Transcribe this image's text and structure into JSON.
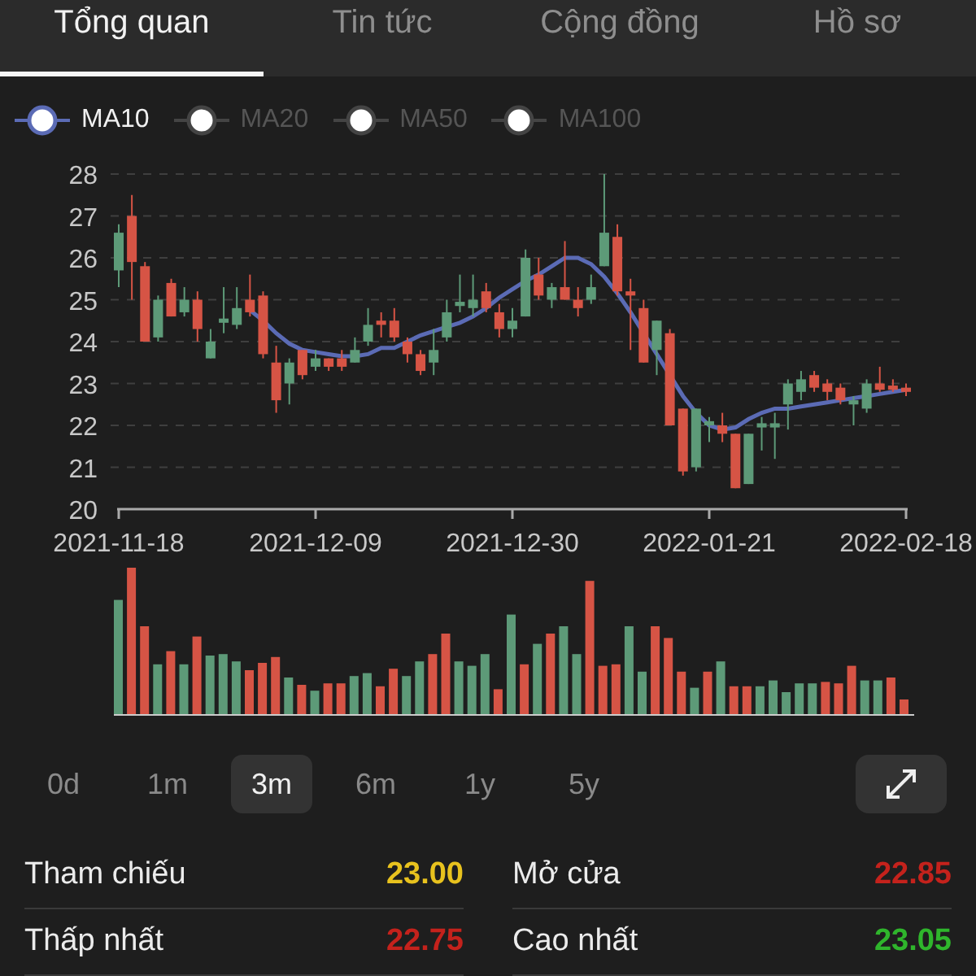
{
  "tabs": [
    {
      "label": "Tổng quan",
      "selected": true
    },
    {
      "label": "Tin tức",
      "selected": false
    },
    {
      "label": "Cộng đồng",
      "selected": false
    },
    {
      "label": "Hồ sơ",
      "selected": false
    }
  ],
  "ma_toggles": [
    {
      "kind": "series",
      "selected": true
    },
    {
      "kind": "plain",
      "label": "MA20",
      "selected": false
    },
    {
      "kind": "plain",
      "label": "MA50",
      "selected": false
    },
    {
      "kind": "plain",
      "label": "MA100",
      "selected": false
    }
  ],
  "price_chart": {
    "chart_data": {
      "type": "candlestick",
      "grid": true,
      "ylim": [
        20,
        28
      ],
      "yticks": [
        20,
        21,
        22,
        23,
        24,
        25,
        26,
        27,
        28
      ],
      "categories": [
        "2021-11-18",
        null,
        null,
        null,
        null,
        null,
        null,
        null,
        null,
        null,
        null,
        null,
        null,
        null,
        null,
        "2021-12-09",
        null,
        null,
        null,
        null,
        null,
        null,
        null,
        null,
        null,
        null,
        null,
        null,
        null,
        null,
        "2021-12-30",
        null,
        null,
        null,
        null,
        null,
        null,
        null,
        null,
        null,
        null,
        null,
        null,
        null,
        null,
        "2022-01-21",
        null,
        null,
        null,
        null,
        null,
        null,
        null,
        null,
        null,
        null,
        null,
        null,
        null,
        null,
        "2022-02-18"
      ],
      "ohlc": [
        [
          25.7,
          26.8,
          25.3,
          26.6
        ],
        [
          27,
          27.5,
          25,
          25.9
        ],
        [
          25.8,
          25.9,
          24,
          24
        ],
        [
          24.1,
          25.1,
          24,
          25
        ],
        [
          25.4,
          25.5,
          24.6,
          24.6
        ],
        [
          24.7,
          25.3,
          24.6,
          25
        ],
        [
          25,
          25.2,
          24,
          24.3
        ],
        [
          23.6,
          24.3,
          23.6,
          24
        ],
        [
          24.45,
          25.3,
          24.2,
          24.55
        ],
        [
          24.4,
          25.3,
          24.3,
          24.8
        ],
        [
          25,
          25.6,
          24.6,
          24.7
        ],
        [
          25.1,
          25.2,
          23.6,
          23.7
        ],
        [
          23.5,
          23.9,
          22.3,
          22.6
        ],
        [
          23,
          23.6,
          22.5,
          23.5
        ],
        [
          23.8,
          23.8,
          23.1,
          23.2
        ],
        [
          23.4,
          23.8,
          23.3,
          23.6
        ],
        [
          23.6,
          23.6,
          23.3,
          23.4
        ],
        [
          23.6,
          23.8,
          23.3,
          23.4
        ],
        [
          23.5,
          24.1,
          23.5,
          23.8
        ],
        [
          24,
          24.8,
          23.9,
          24.4
        ],
        [
          24.5,
          24.7,
          24.1,
          24.4
        ],
        [
          24.5,
          24.8,
          24,
          24.1
        ],
        [
          24,
          24.1,
          23.5,
          23.7
        ],
        [
          23.7,
          23.8,
          23.2,
          23.3
        ],
        [
          23.5,
          24.3,
          23.2,
          23.8
        ],
        [
          24.1,
          25,
          24,
          24.7
        ],
        [
          24.85,
          25.6,
          24.7,
          24.95
        ],
        [
          24.8,
          25.6,
          24.6,
          25
        ],
        [
          25.2,
          25.4,
          24.7,
          24.8
        ],
        [
          24.7,
          24.9,
          24.1,
          24.3
        ],
        [
          24.3,
          24.8,
          24.1,
          24.5
        ],
        [
          24.6,
          26.2,
          24.6,
          26
        ],
        [
          25.6,
          26,
          25,
          25.1
        ],
        [
          25,
          25.4,
          24.8,
          25.3
        ],
        [
          25.3,
          26.4,
          25,
          25
        ],
        [
          25,
          25.3,
          24.6,
          24.8
        ],
        [
          25,
          25.6,
          24.9,
          25.3
        ],
        [
          25.8,
          28,
          25.8,
          26.6
        ],
        [
          26.5,
          26.8,
          25.1,
          25.2
        ],
        [
          25.2,
          25.5,
          23.8,
          25.1
        ],
        [
          24.8,
          25,
          23.5,
          23.5
        ],
        [
          23.8,
          24.5,
          23.2,
          24.5
        ],
        [
          24.2,
          24.3,
          22,
          22
        ],
        [
          22.4,
          22.4,
          20.8,
          20.9
        ],
        [
          21,
          22.4,
          20.9,
          22.4
        ],
        [
          22,
          22.2,
          21.6,
          22.1
        ],
        [
          22,
          22.3,
          21.6,
          21.8
        ],
        [
          21.8,
          21.8,
          20.5,
          20.5
        ],
        [
          20.6,
          21.8,
          20.6,
          21.8
        ],
        [
          21.95,
          22.2,
          21.4,
          22.05
        ],
        [
          21.95,
          22.3,
          21.2,
          22.05
        ],
        [
          22.5,
          23.1,
          21.9,
          23
        ],
        [
          22.8,
          23.3,
          22.6,
          23.1
        ],
        [
          23.2,
          23.3,
          22.8,
          22.9
        ],
        [
          23,
          23.1,
          22.6,
          22.8
        ],
        [
          22.9,
          23,
          22.5,
          22.6
        ],
        [
          22.5,
          22.7,
          22,
          22.6
        ],
        [
          22.4,
          23.1,
          22.3,
          23
        ],
        [
          23,
          23.4,
          22.8,
          22.85
        ],
        [
          22.95,
          23.1,
          22.8,
          22.85
        ],
        [
          22.9,
          23,
          22.7,
          22.8
        ]
      ],
      "series": [
        {
          "name": "MA10",
          "type": "line",
          "color": "#5b6bb5",
          "values": [
            null,
            null,
            null,
            null,
            null,
            null,
            null,
            null,
            null,
            null,
            24.75,
            24.5,
            24.2,
            23.95,
            23.8,
            23.75,
            23.7,
            23.65,
            23.65,
            23.7,
            23.85,
            23.85,
            24.0,
            24.15,
            24.25,
            24.35,
            24.45,
            24.6,
            24.8,
            25.05,
            25.25,
            25.45,
            25.6,
            25.8,
            26.0,
            26.0,
            25.85,
            25.55,
            25.15,
            24.7,
            24.2,
            23.7,
            23.2,
            22.7,
            22.3,
            22.0,
            21.9,
            21.95,
            22.15,
            22.3,
            22.4,
            22.4,
            22.45,
            22.5,
            22.55,
            22.6,
            22.65,
            22.7,
            22.75,
            22.8,
            22.85
          ]
        }
      ]
    }
  },
  "periods": [
    {
      "label": "0d",
      "selected": false
    },
    {
      "label": "1m",
      "selected": false
    },
    {
      "label": "3m",
      "selected": true
    },
    {
      "label": "6m",
      "selected": false
    },
    {
      "label": "1y",
      "selected": false
    },
    {
      "label": "5y",
      "selected": false
    }
  ],
  "stats": [
    {
      "label": "Tham chiếu",
      "value": "23.00",
      "color": "#e8c21e"
    },
    {
      "label": "Mở cửa",
      "value": "22.85",
      "color": "#c4221c"
    },
    {
      "label": "Thấp nhất",
      "value": "22.75",
      "color": "#c4221c"
    },
    {
      "label": "Cao nhất",
      "value": "23.05",
      "color": "#2fb52c"
    }
  ]
}
